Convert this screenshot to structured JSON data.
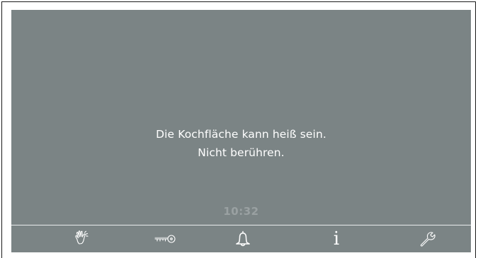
{
  "message": {
    "line1": "Die Kochfläche kann heiß sein.",
    "line2": "Nicht berühren."
  },
  "clock": {
    "time": "10:32"
  },
  "toolbar": {
    "icons": [
      {
        "name": "touch-hand-icon"
      },
      {
        "name": "key-lock-icon"
      },
      {
        "name": "bell-icon"
      },
      {
        "name": "info-icon",
        "glyph": "i"
      },
      {
        "name": "wrench-icon"
      }
    ]
  },
  "colors": {
    "screen_background": "#7b8485",
    "text": "#ffffff",
    "clock_text": "#9aa1a2",
    "divider": "#e9ecec",
    "frame": "#1a1a1a"
  }
}
